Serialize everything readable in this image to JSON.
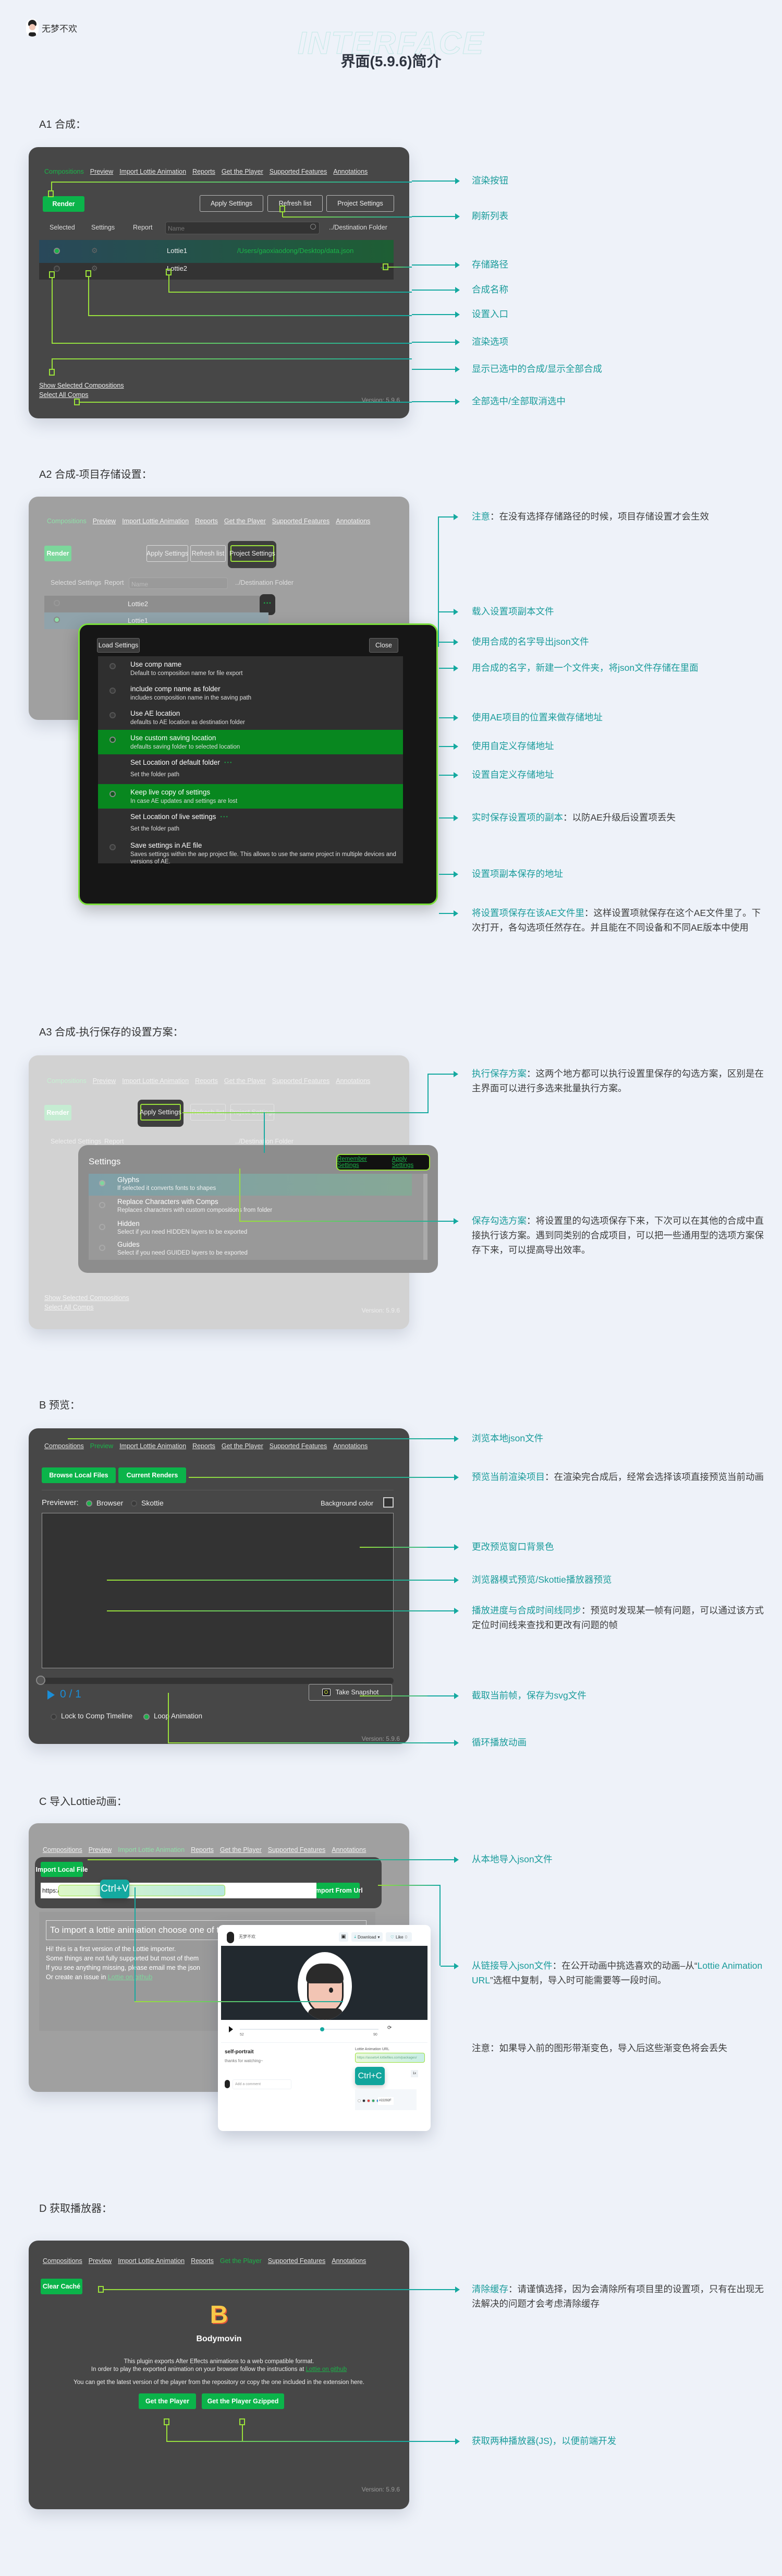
{
  "header": {
    "author": "无梦不欢",
    "watermark": "INTERFACE",
    "title": "界面(5.9.6)简介"
  },
  "tabs": [
    "Compositions",
    "Preview",
    "Import Lottie Animation",
    "Reports",
    "Get the Player",
    "Supported Features",
    "Annotations"
  ],
  "version": "Version: 5.9.6",
  "a1": {
    "label": "A1 合成：",
    "render": "Render",
    "apply_settings": "Apply Settings",
    "refresh_list": "Refresh list",
    "project_settings": "Project Settings",
    "columns": {
      "selected": "Selected",
      "settings": "Settings",
      "report": "Report",
      "destination": "../Destination Folder"
    },
    "search_placeholder": "Name",
    "rows": [
      {
        "name": "Lottie1",
        "path": "/Users/gaoxiaodong/Desktop/data.json",
        "selected": true
      },
      {
        "name": "Lottie2",
        "path": "",
        "selected": false
      }
    ],
    "show_selected": "Show Selected Compositions",
    "select_all": "Select All Comps",
    "callouts": [
      "渲染按钮",
      "刷新列表",
      "存储路径",
      "合成名称",
      "设置入口",
      "渲染选项",
      "显示已选中的合成/显示全部合成",
      "全部选中/全部取消选中"
    ]
  },
  "a2": {
    "label": "A2 合成-项目存储设置：",
    "load_settings": "Load Settings",
    "close": "Close",
    "options": [
      {
        "title": "Use comp name",
        "sub": "Default to composition name for file export",
        "on": false
      },
      {
        "title": "include comp name as folder",
        "sub": "includes composition name in the saving path",
        "on": false
      },
      {
        "title": "Use AE location",
        "sub": "defaults to AE location as destination folder",
        "on": false
      },
      {
        "title": "Use custom saving location",
        "sub": "defaults saving folder to selected location",
        "on": true
      },
      {
        "title": "Set Location of default folder",
        "sub": "Set the folder path",
        "on": false,
        "dots": true
      },
      {
        "title": "Keep live copy of settings",
        "sub": "In case AE updates and settings are lost",
        "on": true
      },
      {
        "title": "Set Location of live settings",
        "sub": "Set the folder path",
        "on": false,
        "dots": true
      },
      {
        "title": "Save settings in AE file",
        "sub": "Saves settings within the aep project file. This allows to use the same project in multiple devices and versions of AE.",
        "on": false
      }
    ],
    "callouts": {
      "note_key": "注意",
      "note_desc": "：在没有选择存储路径的时候，项目存储设置才会生效",
      "items": [
        "载入设置项副本文件",
        "使用合成的名字导出json文件",
        "用合成的名字，新建一个文件夹，将json文件存储在里面",
        "使用AE项目的位置来做存储地址",
        "使用自定义存储地址",
        "设置自定义存储地址"
      ],
      "live_key": "实时保存设置项的副本",
      "live_desc": "：以防AE升级后设置项丢失",
      "live_loc": "设置项副本保存的地址",
      "aefile_key": "将设置项保存在该AE文件里",
      "aefile_desc": "：这样设置项就保存在这个AE文件里了。下次打开，各勾选项任然存在。并且能在不同设备和不同AE版本中使用"
    }
  },
  "a3": {
    "label": "A3 合成-执行保存的设置方案：",
    "settings_title": "Settings",
    "remember_settings": "Remember Settings",
    "apply_settings": "Apply Settings",
    "items": [
      {
        "title": "Glyphs",
        "sub": "If selected it converts fonts to shapes",
        "on": true
      },
      {
        "title": "Replace Characters with Comps",
        "sub": "Replaces characters with custom compositions from folder",
        "on": false
      },
      {
        "title": "Hidden",
        "sub": "Select if you need HIDDEN layers to be exported",
        "on": false
      },
      {
        "title": "Guides",
        "sub": "Select if you need GUIDED layers to be exported",
        "on": false
      }
    ],
    "callouts": {
      "exec_key": "执行保存方案",
      "exec_desc": "：这两个地方都可以执行设置里保存的勾选方案，区别是在主界面可以进行多选来批量执行方案。",
      "save_key": "保存勾选方案",
      "save_desc": "：将设置里的勾选项保存下来，下次可以在其他的合成中直接执行该方案。遇到同类别的合成项目，可以把一些通用型的选项方案保存下来，可以提高导出效率。"
    }
  },
  "b": {
    "label": "B 预览：",
    "browse_local": "Browse Local Files",
    "current_renders": "Current Renders",
    "previewer_label": "Previewer:",
    "previewer_options": [
      {
        "label": "Browser",
        "on": true
      },
      {
        "label": "Skottie",
        "on": false
      }
    ],
    "background_color": "Background color",
    "frame_counter": "0 / 1",
    "progress": 0,
    "take_snapshot": "Take Snapshot",
    "lock_timeline": {
      "label": "Lock to Comp Timeline",
      "on": false
    },
    "loop_animation": {
      "label": "Loop Animation",
      "on": true
    },
    "callouts": {
      "browse": "浏览本地json文件",
      "current_key": "预览当前渲染项目",
      "current_desc": "：在渲染完合成后，经常会选择该项直接预览当前动画",
      "bg": "更改预览窗口背景色",
      "mode": "浏览器模式预览/Skottie播放器预览",
      "sync_key": "播放进度与合成时间线同步",
      "sync_desc": "：预览时发现某一帧有问题，可以通过该方式定位时间线来查找和更改有问题的帧",
      "snapshot": "截取当前帧，保存为svg文件",
      "loop": "循环播放动画"
    }
  },
  "c": {
    "label": "C 导入Lottie动画：",
    "import_local": "Import Local File",
    "url_prefix": "https://",
    "import_url": "Import From Url",
    "paste_hint": "Ctrl+V",
    "copy_hint": "Ctrl+C",
    "intro_box": "To import a lottie animation choose one of th",
    "intro_lines": [
      "Hi! this is a first version of the Lottie importer.",
      "Some things are not fully supported but most of them",
      "If you see anything missing, please email me the json",
      "Or create an issue in "
    ],
    "github_link": "Lottie on github",
    "lottiefiles": {
      "user": "无梦不欢",
      "download": "Download",
      "like": "Like",
      "like_count": "0",
      "frame_start": "52",
      "frame_end": "90",
      "progress": 0.58,
      "anim_title": "self-portrait",
      "anim_desc": "thanks for watching~",
      "url_label": "Lottie Animation URL",
      "url_value": "https://assets4.lottiefiles.com/packages/",
      "speed": "1x",
      "comment_placeholder": "Add a comment",
      "bg_hex": "#22292F",
      "swatches": [
        "#ffffff",
        "#22292f",
        "#e53935",
        "#27ae60",
        "#2d8cf0"
      ]
    },
    "callouts": {
      "local": "从本地导入json文件",
      "url_key": "从链接导入json文件",
      "url_desc1": "：在公开动画中挑选喜欢的动画–从“",
      "url_key2": "Lottie Animation URL",
      "url_desc2": "”选框中复制，导入时可能需要等一段时间。",
      "note": "注意：如果导入前的图形带渐变色，导入后这些渐变色将会丢失"
    }
  },
  "d": {
    "label": "D 获取播放器：",
    "clear_cache": "Clear Caché",
    "logo": "B",
    "name": "Bodymovin",
    "text1": "This plugin exports After Effects animations to a web compatible format.",
    "text2": "In order to play the exported animation on your browser follow the instructions at ",
    "text2_link": "Lottie on github",
    "text3": "You can get the latest version of the player from the repository or copy the one included in the extension here.",
    "get_player": "Get the Player",
    "get_player_gzip": "Get the Player Gzipped",
    "callouts": {
      "cache_key": "清除缓存",
      "cache_desc": "：请谨慎选择，因为会清除所有项目里的设置项，只有在出现无法解决的问题才会考虑清除缓存",
      "players": "获取两种播放器(JS)，以便前端开发"
    }
  }
}
